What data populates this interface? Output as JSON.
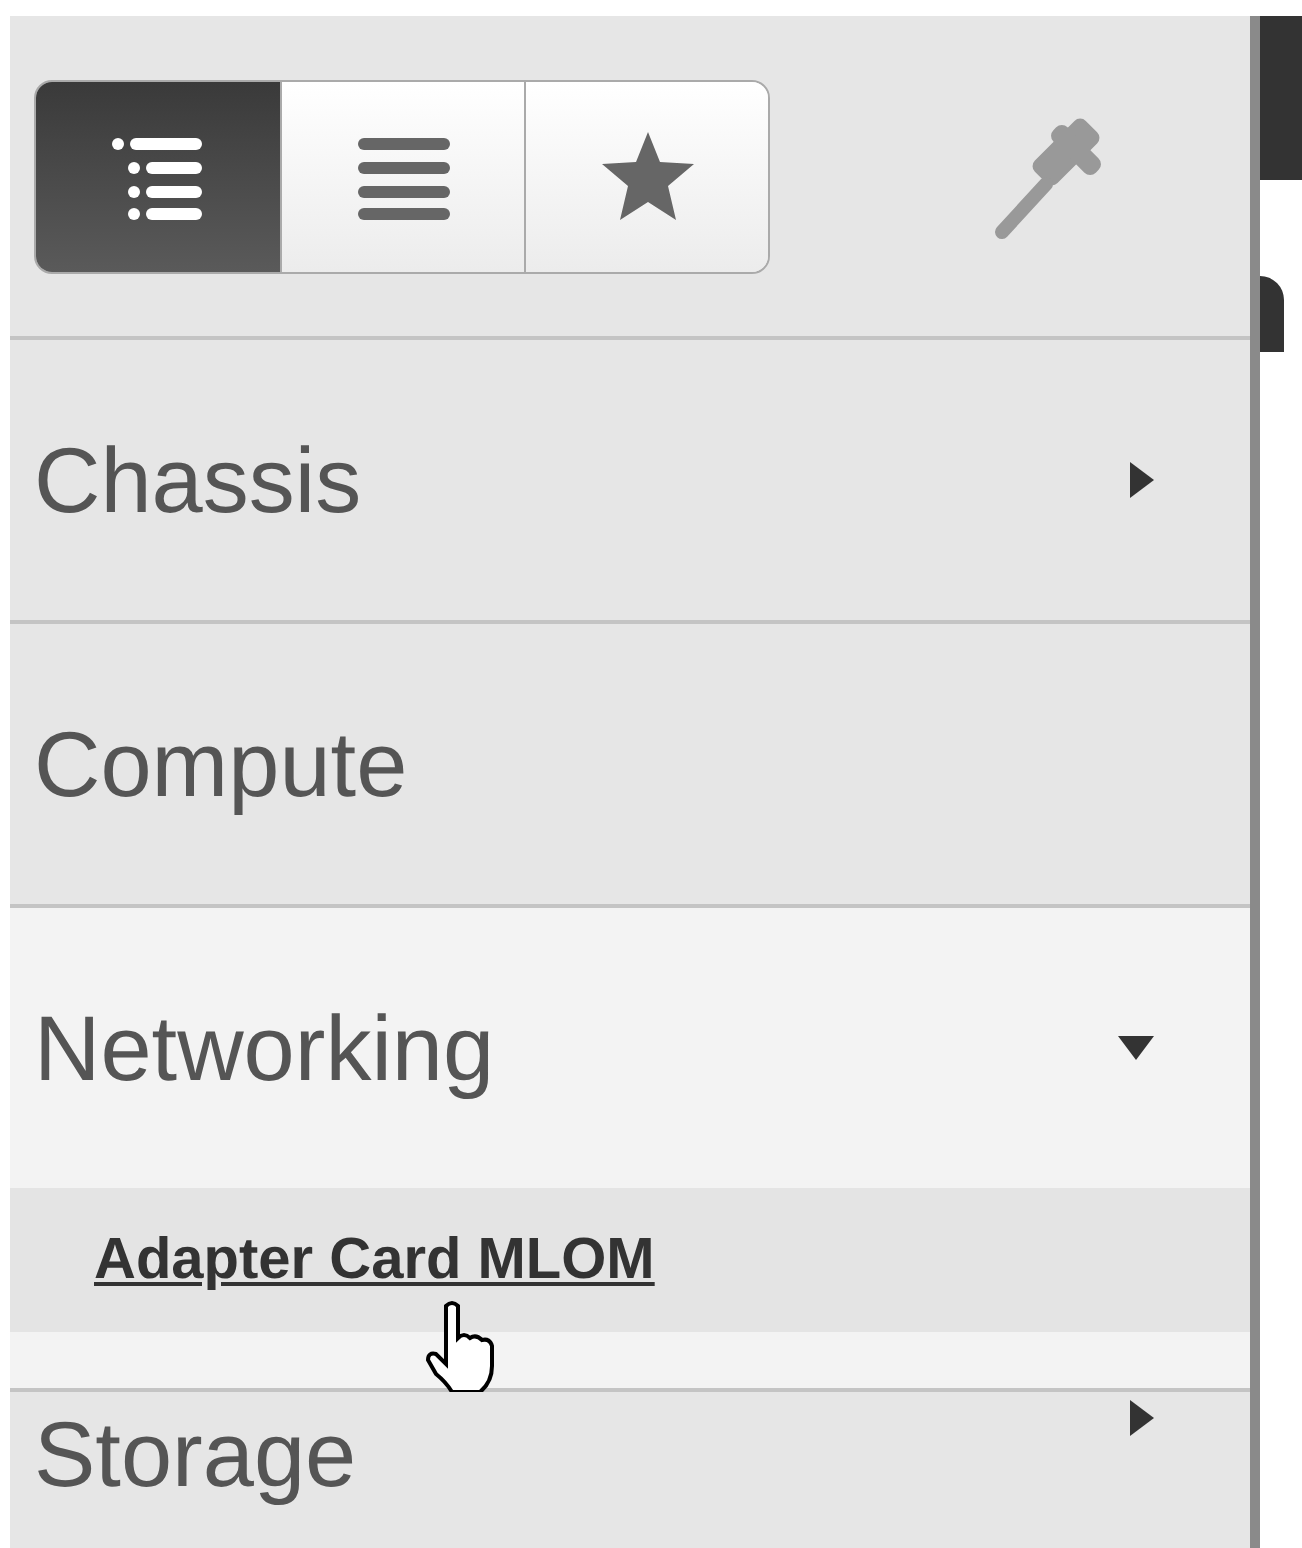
{
  "view_toggle": [
    {
      "kind": "tree",
      "selected": true
    },
    {
      "kind": "list",
      "selected": false
    },
    {
      "kind": "favorites",
      "selected": false
    }
  ],
  "pinned": false,
  "nav": [
    {
      "label": "Chassis",
      "kind": "group",
      "expanded": false
    },
    {
      "label": "Compute",
      "kind": "leaf"
    },
    {
      "label": "Networking",
      "kind": "group",
      "expanded": true,
      "children": [
        {
          "label": "Adapter Card MLOM",
          "hovered": true
        }
      ]
    },
    {
      "label": "Storage",
      "kind": "group",
      "expanded": false
    }
  ]
}
